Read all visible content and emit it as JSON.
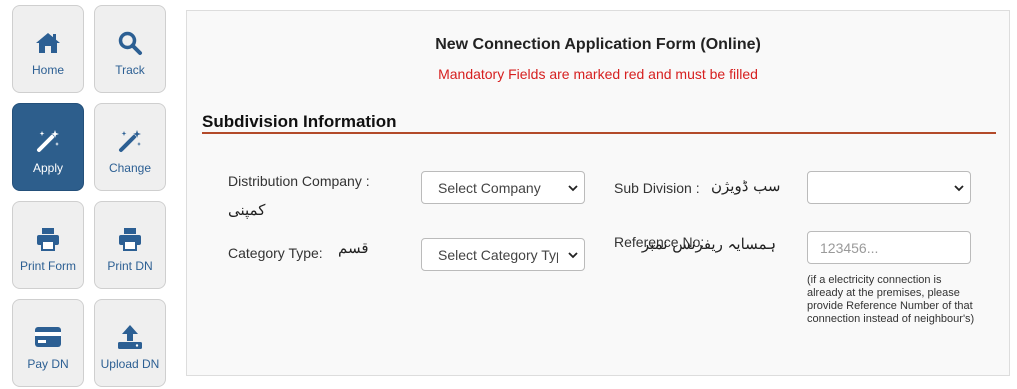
{
  "sidebar": {
    "buttons": [
      {
        "label": "Home",
        "icon": "home-icon"
      },
      {
        "label": "Track",
        "icon": "search-icon"
      },
      {
        "label": "Apply",
        "icon": "magic-wand-icon",
        "active": true
      },
      {
        "label": "Change",
        "icon": "magic-wand-icon"
      },
      {
        "label": "Print Form",
        "icon": "printer-icon"
      },
      {
        "label": "Print DN",
        "icon": "printer-icon"
      },
      {
        "label": "Pay DN",
        "icon": "credit-card-icon"
      },
      {
        "label": "Upload DN",
        "icon": "upload-icon"
      }
    ],
    "colors": {
      "active_bg": "#2d5e8c",
      "text": "#2c5f93"
    }
  },
  "form": {
    "title": "New Connection Application Form (Online)",
    "mandatory_note": "Mandatory Fields are marked red and must be filled",
    "section_title": "Subdivision Information",
    "colors": {
      "mandatory": "#d61f1f",
      "section_rule": "#b34a2a"
    },
    "distribution_company": {
      "label": "Distribution Company :",
      "label_urdu": "کمپنی",
      "selected": "Select Company"
    },
    "sub_division": {
      "label": "Sub Division :",
      "label_urdu": "سب ڈویژن",
      "selected": ""
    },
    "category_type": {
      "label": "Category Type:",
      "label_urdu": "قسم",
      "selected": "Select Category Type"
    },
    "reference_no": {
      "label": "Reference No:",
      "label_urdu": "ہمسایہ ریفرنس نمبر",
      "value": "",
      "placeholder": "123456...",
      "hint": "(if a electricity connection is already at the premises, please provide Reference Number of that connection instead of neighbour's)"
    }
  }
}
